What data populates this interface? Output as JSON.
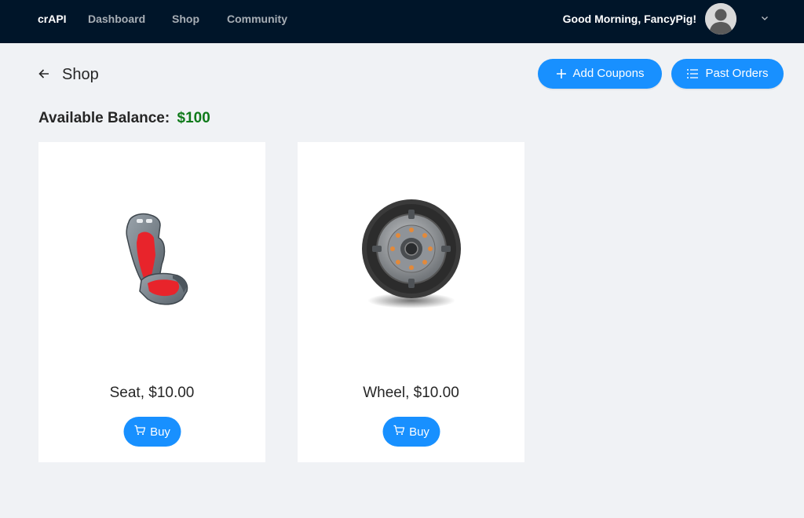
{
  "header": {
    "brand": "crAPI",
    "nav": [
      "Dashboard",
      "Shop",
      "Community"
    ],
    "greeting": "Good Morning, FancyPig!",
    "icons": {
      "avatar": "user-avatar-icon",
      "caret": "chevron-down-icon"
    }
  },
  "page": {
    "title": "Shop",
    "back_icon": "arrow-left-icon"
  },
  "actions": {
    "add_coupons": "Add Coupons",
    "past_orders": "Past Orders"
  },
  "balance": {
    "label": "Available Balance:",
    "amount": "$100"
  },
  "products": [
    {
      "name": "Seat, $10.00",
      "buy_label": "Buy",
      "image": "car-seat-image"
    },
    {
      "name": "Wheel, $10.00",
      "buy_label": "Buy",
      "image": "wheel-image"
    }
  ],
  "colors": {
    "header_bg": "#001529",
    "page_bg": "#f0f2f5",
    "primary": "#1890ff",
    "balance_amount": "#0f7a1a"
  }
}
